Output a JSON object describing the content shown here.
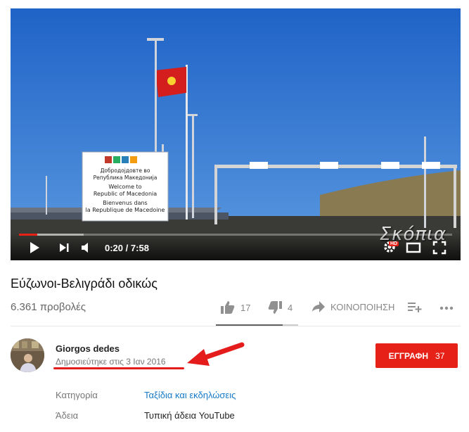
{
  "player": {
    "current_time": "0:20",
    "separator": "/",
    "duration": "7:58",
    "progress_fraction": 0.042,
    "buffered_fraction": 0.15,
    "watermark": "Σκόπια",
    "hd_badge": "HD",
    "sign": {
      "line1": "Добродојдовте во",
      "line2": "Република Македонија",
      "line3": "Welcome to",
      "line4": "Republic of Macedonia",
      "line5": "Bienvenus dans",
      "line6": "la Republique de Macedoine"
    }
  },
  "video": {
    "title": "Εύζωνοι-Βελιγράδι οδικώς",
    "views": "6.361 προβολές",
    "likes": "17",
    "dislikes": "4",
    "share_label": "ΚΟΙΝΟΠΟΙΗΣΗ",
    "like_ratio": 0.81
  },
  "channel": {
    "name": "Giorgos dedes",
    "published": "Δημοσιεύτηκε στις 3 Ιαν 2016",
    "subscribe_label": "ΕΓΓΡΑΦΗ",
    "subscriber_count": "37"
  },
  "metadata": {
    "category_label": "Κατηγορία",
    "category_value": "Ταξίδια και εκδηλώσεις",
    "license_label": "Άδεια",
    "license_value": "Τυπική άδεια YouTube"
  },
  "colors": {
    "accent": "#e62117",
    "link": "#167ac6",
    "annotation": "#e41c1c"
  }
}
